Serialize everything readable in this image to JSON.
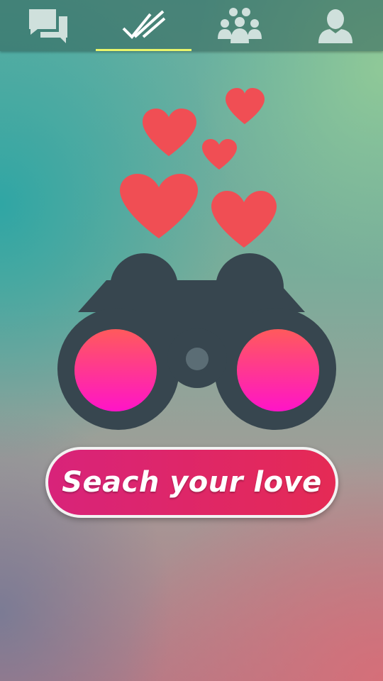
{
  "tabs": [
    {
      "icon": "chat-bubbles-icon",
      "active": false
    },
    {
      "icon": "double-check-icon",
      "active": true
    },
    {
      "icon": "group-icon",
      "active": false
    },
    {
      "icon": "profile-icon",
      "active": false
    }
  ],
  "illustration": {
    "hearts_color": "#f04e54",
    "binoculars_color": "#37464f",
    "lens_gradient": [
      "#ff5a5c",
      "#ff14c8"
    ]
  },
  "cta": {
    "label": "Seach your love"
  },
  "colors": {
    "tab_indicator": "#e9f56b",
    "cta_start": "#d8237a",
    "cta_end": "#e52a55"
  }
}
